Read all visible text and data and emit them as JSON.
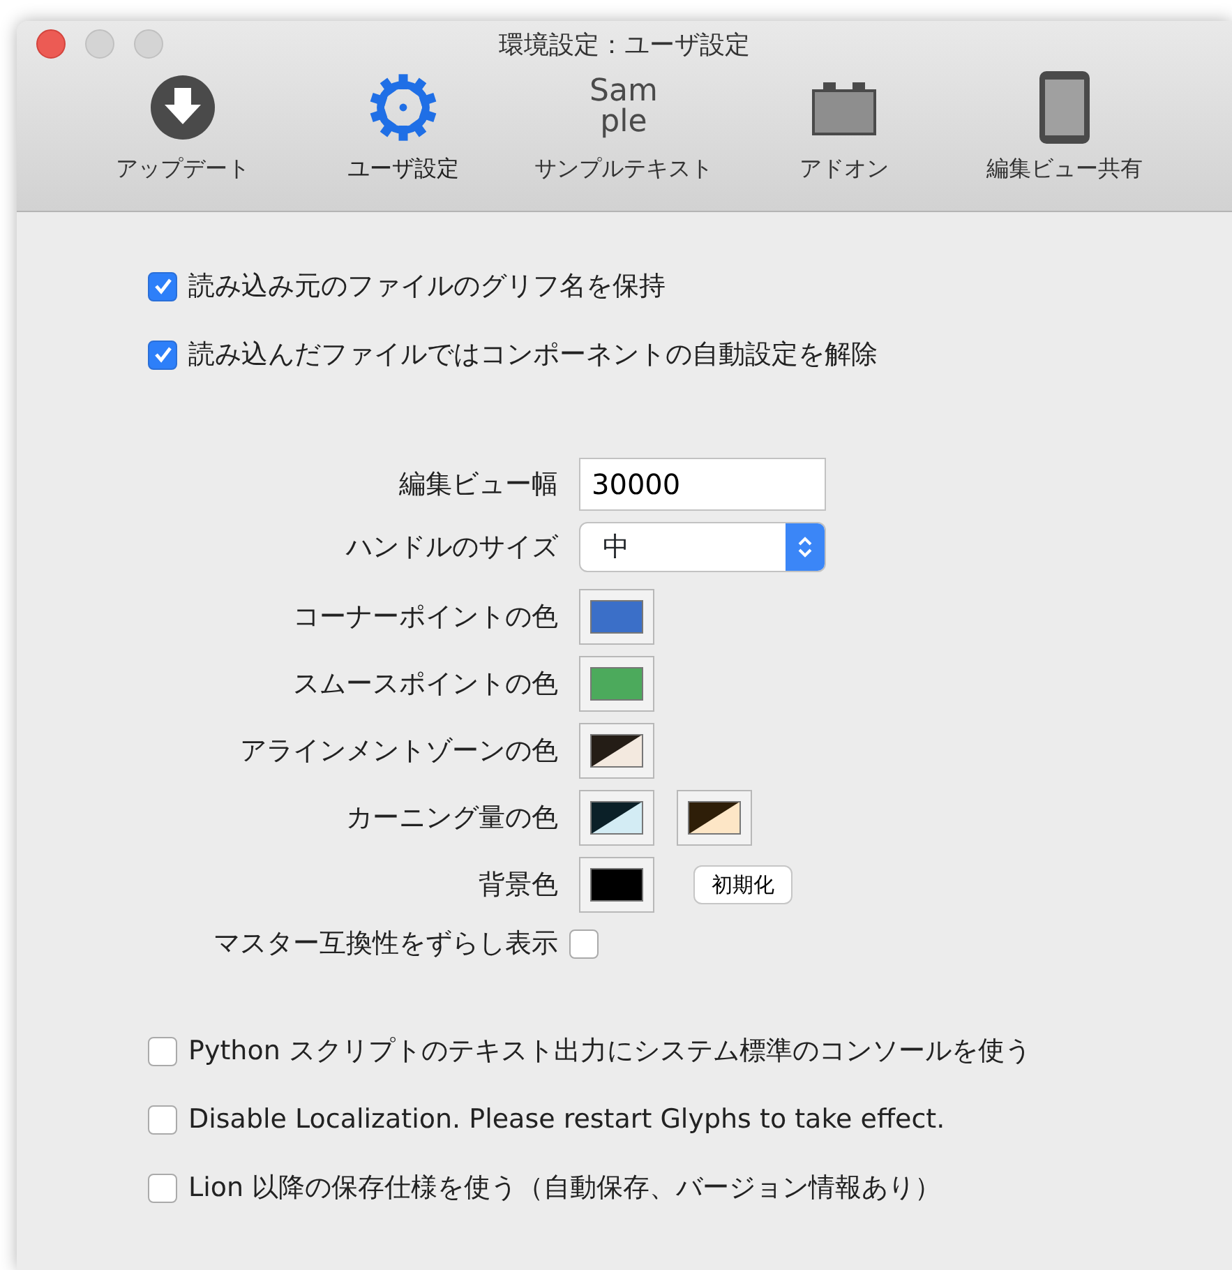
{
  "window": {
    "title": "環境設定：ユーザ設定"
  },
  "toolbar": [
    {
      "kind": "download",
      "label": "アップデート",
      "selected": false
    },
    {
      "kind": "gear",
      "label": "ユーザ設定",
      "selected": true
    },
    {
      "kind": "sample",
      "label": "サンプルテキスト",
      "icon_text": [
        "Sam",
        "ple"
      ],
      "selected": false
    },
    {
      "kind": "plugin",
      "label": "アドオン",
      "selected": false
    },
    {
      "kind": "tablet",
      "label": "編集ビュー共有",
      "selected": false
    }
  ],
  "top_options": [
    {
      "label": "読み込み元のファイルのグリフ名を保持",
      "checked": true
    },
    {
      "label": "読み込んだファイルではコンポーネントの自動設定を解除",
      "checked": true
    }
  ],
  "settings": [
    {
      "kind": "text",
      "label": "編集ビュー幅",
      "value": "30000"
    },
    {
      "kind": "popup",
      "label": "ハンドルのサイズ",
      "value": "中"
    },
    {
      "kind": "colors",
      "label": "コーナーポイントの色",
      "swatches": [
        {
          "parts": [
            {
              "color": "#3b6fc8"
            }
          ]
        }
      ]
    },
    {
      "kind": "colors",
      "label": "スムースポイントの色",
      "swatches": [
        {
          "parts": [
            {
              "color": "#4caa5c"
            }
          ]
        }
      ]
    },
    {
      "kind": "colors",
      "label": "アラインメントゾーンの色",
      "swatches": [
        {
          "parts": [
            {
              "color": "#241d16"
            },
            {
              "color": "#f3e9df"
            }
          ]
        }
      ]
    },
    {
      "kind": "colors",
      "label": "カーニング量の色",
      "swatches": [
        {
          "parts": [
            {
              "color": "#0b2028"
            },
            {
              "color": "#d3ecf4"
            }
          ]
        },
        {
          "parts": [
            {
              "color": "#2e1e08"
            },
            {
              "color": "#fde6c6"
            }
          ]
        }
      ]
    },
    {
      "kind": "colors",
      "label": "背景色",
      "swatches": [
        {
          "parts": [
            {
              "color": "#000000"
            }
          ]
        }
      ],
      "button": "初期化"
    },
    {
      "kind": "checkbox",
      "label": "マスター互換性をずらし表示",
      "checked": false
    }
  ],
  "bottom_options": [
    {
      "label": "Python スクリプトのテキスト出力にシステム標準のコンソールを使う",
      "checked": false
    },
    {
      "label": "Disable Localization. Please restart Glyphs to take effect.",
      "checked": false
    },
    {
      "label": "Lion 以降の保存仕様を使う（自動保存、バージョン情報あり）",
      "checked": false
    }
  ]
}
